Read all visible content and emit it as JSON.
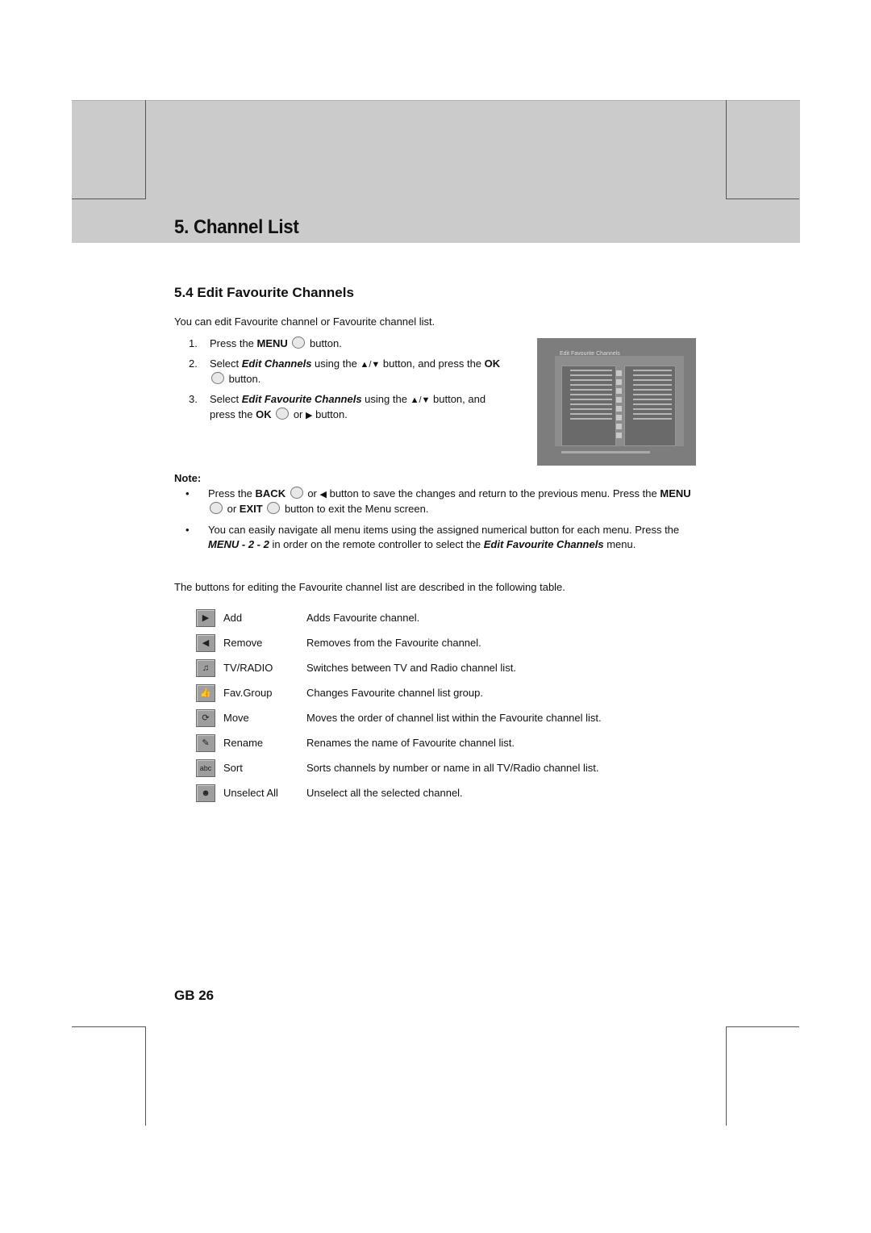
{
  "chapter": {
    "title": "5. Channel List"
  },
  "section": {
    "title": "5.4 Edit Favourite Channels",
    "intro": "You can edit Favourite channel or Favourite channel list."
  },
  "steps": [
    {
      "num": "1.",
      "parts": [
        "Press the ",
        "MENU",
        " button."
      ]
    },
    {
      "num": "2.",
      "parts": [
        "Select ",
        "Edit Channels",
        " using the ",
        " button, and press the ",
        "OK",
        " button."
      ]
    },
    {
      "num": "3.",
      "parts": [
        "Select ",
        "Edit Favourite Channels",
        " using the ",
        " button, and press the ",
        "OK",
        " or ",
        " button."
      ]
    }
  ],
  "screenshot": {
    "title": "Edit Favourite Channels",
    "alt": "Edit Favourite Channels menu screen"
  },
  "note": {
    "label": "Note:",
    "items": [
      {
        "bullet": "•",
        "text_a": "Press the ",
        "bold_a": "BACK",
        "text_b": " or ",
        "text_c": " button to save the changes and return to the previous menu. Press the ",
        "bold_b": "MENU",
        "text_d": " or ",
        "bold_c": "EXIT",
        "text_e": " button to exit the Menu screen."
      },
      {
        "bullet": "•",
        "text_a": "You can easily navigate all menu items using the assigned numerical button for each menu. Press the ",
        "bold_a": "MENU - 2 - 2",
        "text_b": " in order on the remote controller to select the ",
        "bold_b": "Edit Favourite Channels",
        "text_c": " menu."
      }
    ]
  },
  "table": {
    "intro": "The buttons for editing the Favourite channel list are described in the following table.",
    "rows": [
      {
        "icon": "right-arrow-icon",
        "glyph": "▶",
        "name": "Add",
        "desc": "Adds Favourite channel."
      },
      {
        "icon": "left-arrow-icon",
        "glyph": "◀",
        "name": "Remove",
        "desc": "Removes from the Favourite channel."
      },
      {
        "icon": "music-note-icon",
        "glyph": "♫",
        "name": "TV/RADIO",
        "desc": "Switches between TV and Radio channel list."
      },
      {
        "icon": "thumbs-up-icon",
        "glyph": "👍",
        "name": "Fav.Group",
        "desc": "Changes Favourite channel list group."
      },
      {
        "icon": "rotate-icon",
        "glyph": "⟳",
        "name": "Move",
        "desc": "Moves the order of channel list within the Favourite channel list."
      },
      {
        "icon": "pen-icon",
        "glyph": "✎",
        "name": "Rename",
        "desc": "Renames the name of Favourite channel list."
      },
      {
        "icon": "abc-icon",
        "glyph": "abc",
        "name": "Sort",
        "desc": "Sorts channels by number or name in all TV/Radio channel list."
      },
      {
        "icon": "person-icon",
        "glyph": "☻",
        "name": "Unselect All",
        "desc": "Unselect all the selected channel."
      }
    ]
  },
  "footer": {
    "page": "GB 26"
  }
}
